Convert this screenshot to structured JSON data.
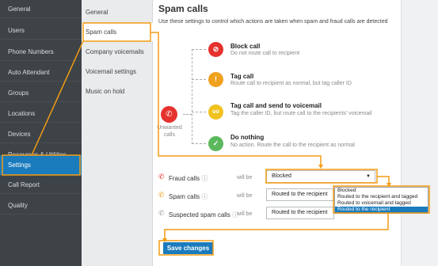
{
  "nav": {
    "items": [
      "General",
      "Users",
      "Phone Numbers",
      "Auto Attendant",
      "Groups",
      "Locations",
      "Devices",
      "Resources & Utilities",
      "Settings",
      "Call Report",
      "Quality"
    ],
    "active": "Settings"
  },
  "subnav": {
    "items": [
      "General",
      "Spam calls",
      "Company voicemails",
      "Voicemail settings",
      "Music on hold"
    ],
    "active": "Spam calls"
  },
  "main": {
    "title": "Spam calls",
    "description": "Use these settings to control which actions are taken when spam and fraud calls are detected",
    "center_label_line1": "Unwanted",
    "center_label_line2": "calls",
    "options": [
      {
        "title": "Block call",
        "desc": "Do not route call to recipient",
        "icon": "block-icon",
        "color": "#e5322d"
      },
      {
        "title": "Tag call",
        "desc": "Route call to recipient as normal, but tag caller ID",
        "icon": "tag-icon",
        "color": "#f0a11f"
      },
      {
        "title": "Tag call and send to voicemail",
        "desc": "Tag the caller ID, but route call to the recipients' voicemail",
        "icon": "voicemail-icon",
        "color": "#f0c21f"
      },
      {
        "title": "Do nothing",
        "desc": "No action. Route the call to the recipient as normal",
        "icon": "check-icon",
        "color": "#5cb85c"
      }
    ],
    "rules": [
      {
        "label": "Fraud calls",
        "will_be": "will be",
        "value": "Blocked",
        "icon_color": "#e5322d"
      },
      {
        "label": "Spam calls",
        "will_be": "will be",
        "value": "Routed to the recipient",
        "icon_color": "#f0a11f"
      },
      {
        "label": "Suspected spam calls",
        "will_be": "will be",
        "value": "Routed to the recipient",
        "icon_color": "#9aa0a6"
      }
    ],
    "save_label": "Save changes"
  },
  "dropdown": {
    "options": [
      "Blocked",
      "Routed to the recipient and tagged",
      "Routed to voicemail and tagged",
      "Routed to the recipient"
    ],
    "selected": "Routed to the recipient"
  },
  "colors": {
    "accent": "#1a7bbd",
    "annotation": "#f39c12",
    "nav_bg": "#3e4348"
  }
}
